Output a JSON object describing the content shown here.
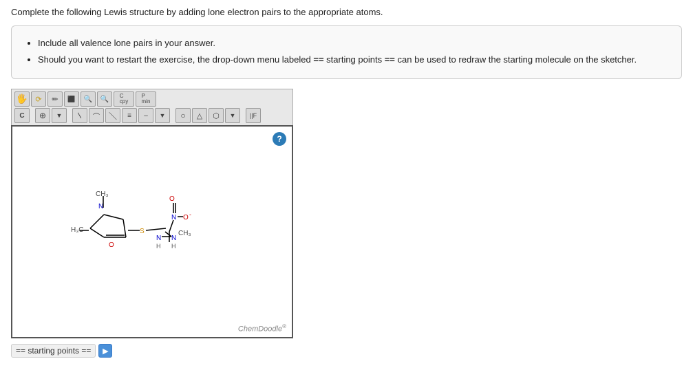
{
  "page": {
    "instructions": "Complete the following Lewis structure by adding lone electron pairs to the appropriate atoms.",
    "info_bullets": [
      "Include all valence lone pairs in your answer.",
      "Should you want to restart the exercise, the drop-down menu labeled == starting points == can be used to redraw the starting molecule on the sketcher."
    ],
    "double_eq_symbol": "==",
    "starting_points_label": "== starting points ==",
    "help_icon_symbol": "?",
    "chemdoodle_label": "ChemDoodle",
    "chemdoodle_sup": "®"
  },
  "toolbar": {
    "row1_buttons": [
      "✋",
      "↩",
      "✏",
      "⬡",
      "🔍",
      "🔍",
      "C",
      "P"
    ],
    "row2_buttons": [
      "C",
      "⊕",
      "▼",
      "/",
      "∧",
      "\\",
      "≡",
      "–",
      "▼",
      "○",
      "△",
      "○",
      "▼",
      "||F"
    ]
  },
  "dropdown": {
    "label": "== starting points ==",
    "arrow": "▸"
  }
}
